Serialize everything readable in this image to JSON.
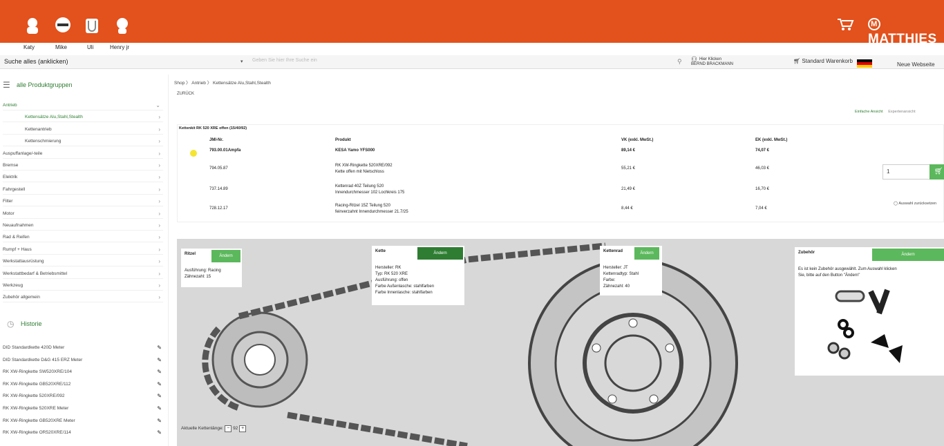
{
  "users": [
    {
      "name": "Katy"
    },
    {
      "name": "Mike"
    },
    {
      "name": "Uli"
    },
    {
      "name": "Henry jr"
    }
  ],
  "brand": {
    "logo": "MATTHIES",
    "accent": "#e3511c",
    "green": "#5cb85c"
  },
  "search": {
    "select_label": "Suche alles (anklicken)",
    "placeholder": "Geben Sie hier Ihre Suche ein"
  },
  "header": {
    "login_line1": "Hier Klicken",
    "login_line2": "BERND BRACKMANN",
    "cart_label": "Standard Warenkorb",
    "new_web_label": "Neue Webseite"
  },
  "sidebar": {
    "title": "alle Produktgruppen",
    "items": [
      {
        "label": "Antrieb",
        "active": true
      },
      {
        "label": "Kettensätze Alu,Stahl,Stealth",
        "active": true,
        "sub": true
      },
      {
        "label": "Kettenantrieb",
        "sub": true
      },
      {
        "label": "Kettenschmierung",
        "sub": true
      },
      {
        "label": "Auspuffanlage/-teile"
      },
      {
        "label": "Bremse"
      },
      {
        "label": "Elektrik"
      },
      {
        "label": "Fahrgestell"
      },
      {
        "label": "Filter"
      },
      {
        "label": "Motor"
      },
      {
        "label": "Neuaufnahmen"
      },
      {
        "label": "Rad & Reifen"
      },
      {
        "label": "Rumpf + Haus"
      },
      {
        "label": "Werkstattausrüstung"
      },
      {
        "label": "Werkstattbedarf & Betriebsmittel"
      },
      {
        "label": "Werkzeug"
      },
      {
        "label": "Zubehör allgemein"
      }
    ],
    "history_title": "Historie",
    "history": [
      "DID Standardkette 420D Meter",
      "DID Standardkette D&G 415 ERZ Meter",
      "RK XW-Ringkette SW520XRE/104",
      "RK XW-Ringkette GB520XRE/112",
      "RK XW-Ringkette 520XRE/092",
      "RK XW-Ringkette 520XRE Meter",
      "RK XW-Ringkette GB520XRE Meter",
      "RK XW-Ringkette OR520XRE/114"
    ]
  },
  "breadcrumb": "Shop  〉 Antrieb  〉 Kettensätze Alu,Stahl,Stealth",
  "back_label": "ZURÜCK",
  "view_tabs": [
    "Einfache Ansicht",
    "Expertenansicht"
  ],
  "table": {
    "title": "Kettenkit RK 520 XRE offen (15/40/92)",
    "headers": [
      "JMI-Nr.",
      "Produkt",
      "VK (exkl. MwSt.)",
      "EK (exkl. MwSt.)"
    ],
    "rows": [
      {
        "nr": "793.00.01Ampfa",
        "product": "KESA Yamo YFS000",
        "product2": "",
        "vk": "89,14 €",
        "ek": "74,07 €",
        "bold": true
      },
      {
        "nr": "794.05.87",
        "product": "RK XW-Ringkette 520XRE/092",
        "product2": "Kette offen mit Nietschloss",
        "vk": "55,21 €",
        "ek": "46,03 €"
      },
      {
        "nr": "737.14.89",
        "product": "Kettenrad 40Z Teilung 520",
        "product2": "Innendurchmesser 102 Lochkreis 175",
        "vk": "21,49 €",
        "ek": "16,70 €"
      },
      {
        "nr": "728.12.17",
        "product": "Racing-Ritzel 15Z Teilung 520",
        "product2": "feinverzahnt Innendurchmesser 21.7/25",
        "vk": "8,44 €",
        "ek": "7,04 €"
      }
    ],
    "qty": "1",
    "reset_label": "Auswahl zurücksetzen"
  },
  "cards": {
    "ritzel": {
      "title": "Ritzel",
      "button": "Ändern",
      "lines": [
        "Ausführung: Racing",
        "Zähnezahl: 15"
      ]
    },
    "kette": {
      "title": "Kette",
      "button": "Ändern",
      "lines": [
        "Hersteller: RK",
        "Typ: RK 520 XRE",
        "Ausführung: offen",
        "Farbe Außenlasche: stahlfarben",
        "Farbe Innenlasche: stahlfarben"
      ]
    },
    "kettenrad": {
      "title": "Kettenrad",
      "button": "Ändern",
      "lines": [
        "Hersteller: JT",
        "Kettenradtyp: Stahl",
        "Farbe:",
        "Zähnezahl: 40"
      ]
    },
    "zubehoer": {
      "title": "Zubehör",
      "button": "Ändern",
      "lines": [
        "Es ist kein Zubehör ausgewählt. Zum Auswahl klicken",
        "Sie, bitte auf den Button \"Ändern\""
      ]
    }
  },
  "chain_length": {
    "label": "Aktuelle Kettenlänge:",
    "value": "92",
    "minus": "−",
    "plus": "+"
  }
}
